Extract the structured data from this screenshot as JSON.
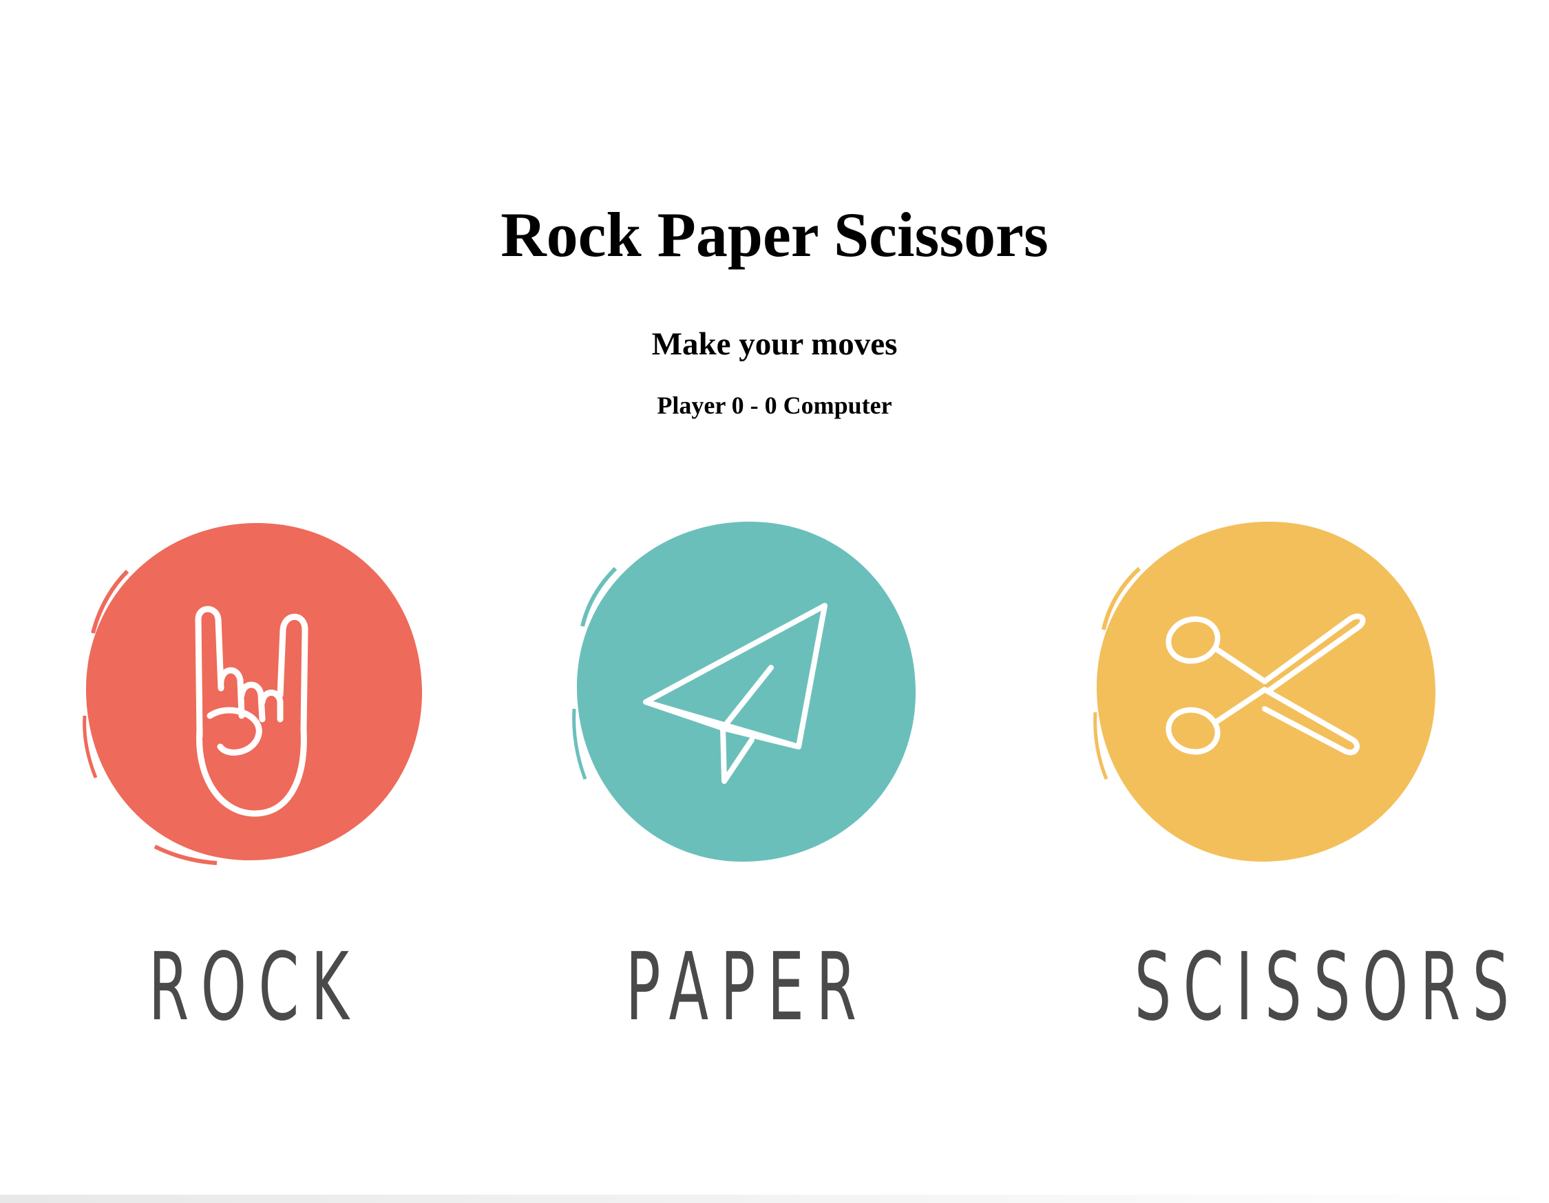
{
  "page": {
    "title": "Rock Paper Scissors",
    "subtitle": "Make your moves",
    "score": "Player 0 - 0 Computer"
  },
  "choices": [
    {
      "label": "ROCK",
      "icon": "rock-hand-icon",
      "color": "#EE6A5A"
    },
    {
      "label": "PAPER",
      "icon": "paper-plane-icon",
      "color": "#6BBFBB"
    },
    {
      "label": "SCISSORS",
      "icon": "scissors-icon",
      "color": "#F3BF5B"
    }
  ]
}
